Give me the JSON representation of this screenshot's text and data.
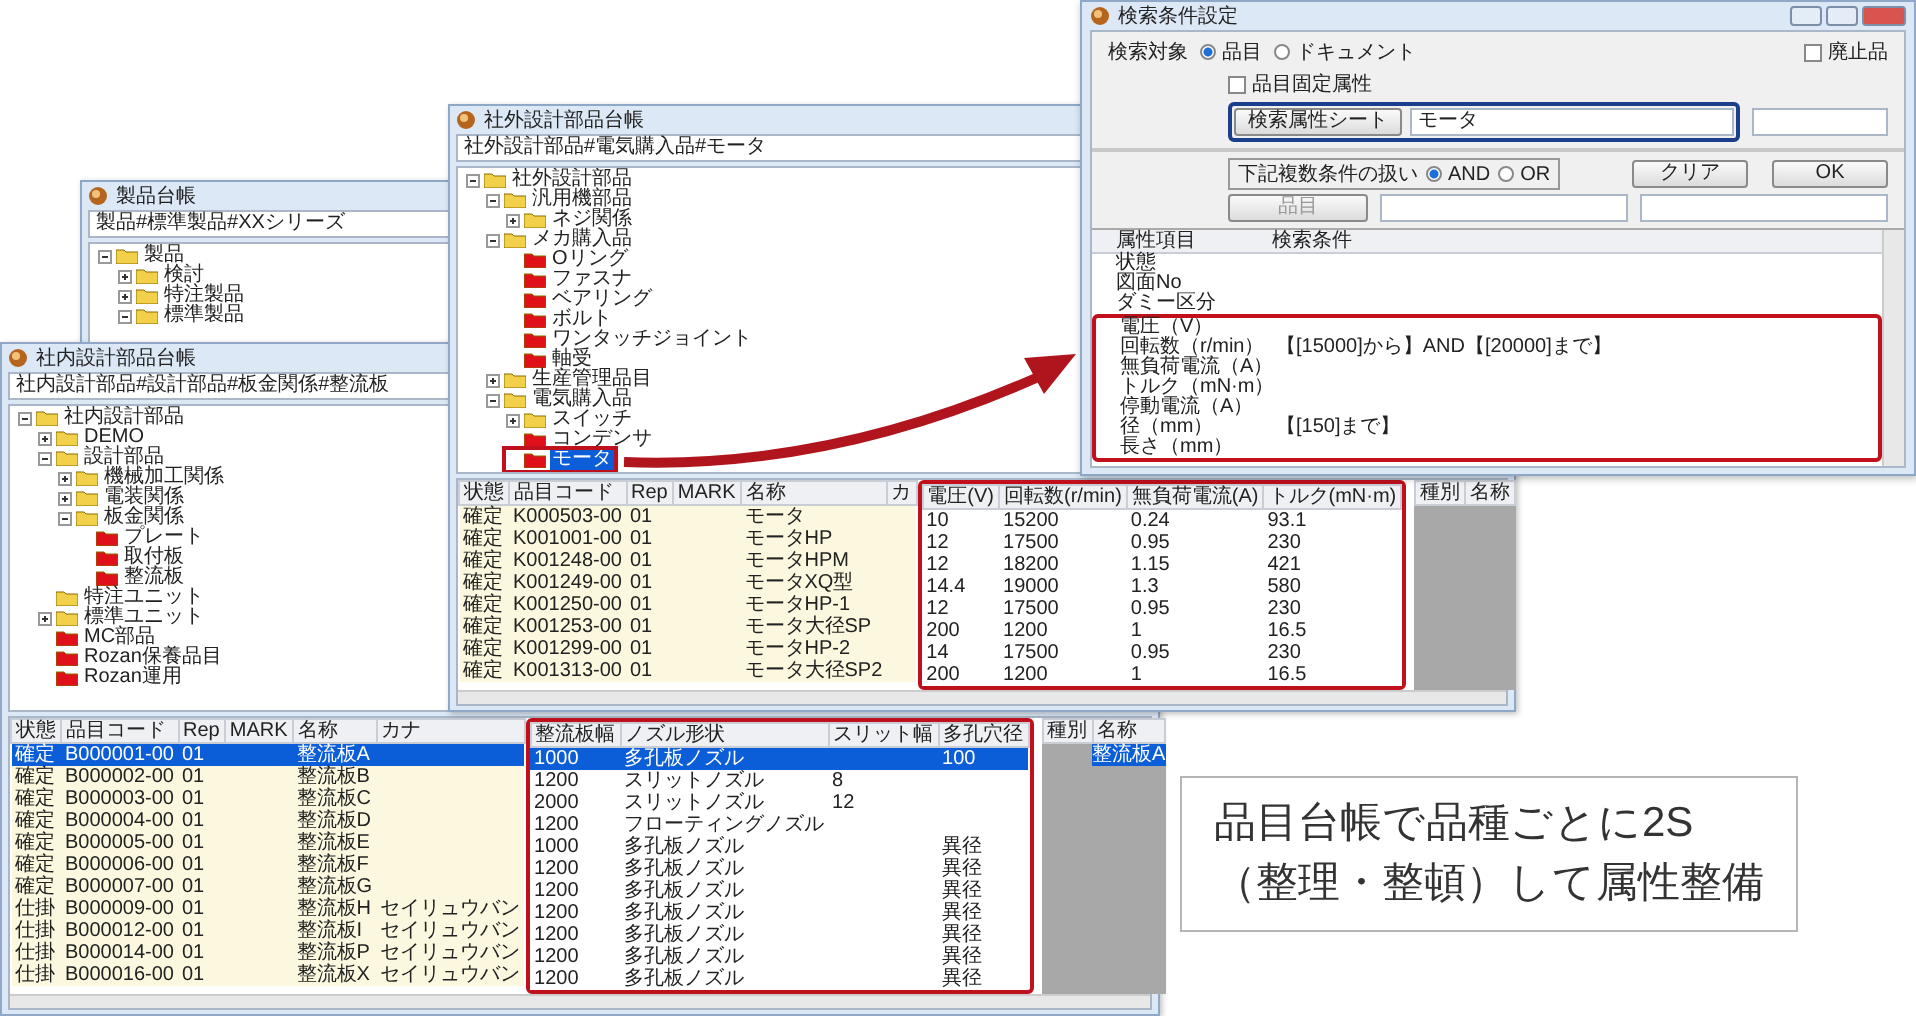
{
  "back_window": {
    "title": "製品台帳",
    "path": "製品#標準製品#XXシリーズ",
    "tree": [
      {
        "label": "製品",
        "kind": "folder",
        "expanded": true,
        "selected": false,
        "children": [
          {
            "label": "検討",
            "kind": "folder",
            "expanded": false,
            "selected": false
          },
          {
            "label": "特注製品",
            "kind": "folder",
            "expanded": false,
            "selected": false
          },
          {
            "label": "標準製品",
            "kind": "folder",
            "expanded": true,
            "selected": false
          }
        ]
      }
    ]
  },
  "left_window": {
    "title": "社内設計部品台帳",
    "path": "社内設計部品#設計部品#板金関係#整流板",
    "tree": [
      {
        "label": "社内設計部品",
        "kind": "folder",
        "expanded": true,
        "selected": false,
        "children": [
          {
            "label": "DEMO",
            "kind": "folder",
            "expanded": false,
            "selected": false
          },
          {
            "label": "設計部品",
            "kind": "folder",
            "expanded": true,
            "selected": false,
            "children": [
              {
                "label": "機械加工関係",
                "kind": "folder",
                "expanded": false,
                "selected": false
              },
              {
                "label": "電装関係",
                "kind": "folder",
                "expanded": false,
                "selected": false
              },
              {
                "label": "板金関係",
                "kind": "folder",
                "expanded": true,
                "selected": false,
                "children": [
                  {
                    "label": "プレート",
                    "kind": "leaf",
                    "selected": false
                  },
                  {
                    "label": "取付板",
                    "kind": "leaf",
                    "selected": false
                  },
                  {
                    "label": "整流板",
                    "kind": "leaf",
                    "selected": false
                  }
                ]
              }
            ]
          },
          {
            "label": "特注ユニット",
            "kind": "folder",
            "selected": false
          },
          {
            "label": "標準ユニット",
            "kind": "folder",
            "expanded": false,
            "selected": false
          },
          {
            "label": "MC部品",
            "kind": "leaf",
            "selected": false
          },
          {
            "label": "Rozan保養品目",
            "kind": "leaf",
            "selected": false
          },
          {
            "label": "Rozan運用",
            "kind": "leaf",
            "selected": false
          }
        ]
      }
    ],
    "table": {
      "columns": [
        "状態",
        "品目コード",
        "Rep",
        "MARK",
        "名称",
        "カナ"
      ],
      "highlighted_columns": [
        "整流板幅",
        "ノズル形状",
        "スリット幅",
        "多孔穴径"
      ],
      "rows": [
        {
          "selected": true,
          "cells": [
            "確定",
            "B000001-00",
            "01",
            null,
            "整流板A",
            null
          ],
          "highlighted_cells": [
            "1000",
            "多孔板ノズル",
            null,
            "100"
          ]
        },
        {
          "selected": false,
          "cells": [
            "確定",
            "B000002-00",
            "01",
            null,
            "整流板B",
            null
          ],
          "highlighted_cells": [
            "1200",
            "スリットノズル",
            "8",
            null
          ]
        },
        {
          "selected": false,
          "cells": [
            "確定",
            "B000003-00",
            "01",
            null,
            "整流板C",
            null
          ],
          "highlighted_cells": [
            "2000",
            "スリットノズル",
            "12",
            null
          ]
        },
        {
          "selected": false,
          "cells": [
            "確定",
            "B000004-00",
            "01",
            null,
            "整流板D",
            null
          ],
          "highlighted_cells": [
            "1200",
            "フローティングノズル",
            null,
            null
          ]
        },
        {
          "selected": false,
          "cells": [
            "確定",
            "B000005-00",
            "01",
            null,
            "整流板E",
            null
          ],
          "highlighted_cells": [
            "1000",
            "多孔板ノズル",
            null,
            "異径"
          ]
        },
        {
          "selected": false,
          "cells": [
            "確定",
            "B000006-00",
            "01",
            null,
            "整流板F",
            null
          ],
          "highlighted_cells": [
            "1200",
            "多孔板ノズル",
            null,
            "異径"
          ]
        },
        {
          "selected": false,
          "cells": [
            "確定",
            "B000007-00",
            "01",
            null,
            "整流板G",
            null
          ],
          "highlighted_cells": [
            "1200",
            "多孔板ノズル",
            null,
            "異径"
          ]
        },
        {
          "selected": false,
          "cells": [
            "仕掛",
            "B000009-00",
            "01",
            null,
            "整流板H",
            "セイリュウバン"
          ],
          "highlighted_cells": [
            "1200",
            "多孔板ノズル",
            null,
            "異径"
          ]
        },
        {
          "selected": false,
          "cells": [
            "仕掛",
            "B000012-00",
            "01",
            null,
            "整流板I",
            "セイリュウバン"
          ],
          "highlighted_cells": [
            "1200",
            "多孔板ノズル",
            null,
            "異径"
          ]
        },
        {
          "selected": false,
          "cells": [
            "仕掛",
            "B000014-00",
            "01",
            null,
            "整流板P",
            "セイリュウバン"
          ],
          "highlighted_cells": [
            "1200",
            "多孔板ノズル",
            null,
            "異径"
          ]
        },
        {
          "selected": false,
          "cells": [
            "仕掛",
            "B000016-00",
            "01",
            null,
            "整流板X",
            "セイリュウバン"
          ],
          "highlighted_cells": [
            "1200",
            "多孔板ノズル",
            null,
            "異径"
          ]
        }
      ]
    },
    "side_table": {
      "columns": [
        "種別",
        "名称"
      ],
      "rows": [
        {
          "selected": true,
          "cells": [
            null,
            "整流板A"
          ]
        }
      ]
    }
  },
  "middle_window": {
    "title": "社外設計部品台帳",
    "path": "社外設計部品#電気購入品#モータ",
    "tree": [
      {
        "label": "社外設計部品",
        "kind": "folder",
        "expanded": true,
        "selected": false,
        "children": [
          {
            "label": "汎用機部品",
            "kind": "folder",
            "expanded": true,
            "selected": false,
            "children": [
              {
                "label": "ネジ関係",
                "kind": "folder",
                "expanded": false,
                "selected": false
              }
            ]
          },
          {
            "label": "メカ購入品",
            "kind": "folder",
            "expanded": true,
            "selected": false,
            "children": [
              {
                "label": "Oリング",
                "kind": "leaf",
                "selected": false
              },
              {
                "label": "ファスナ",
                "kind": "leaf",
                "selected": false
              },
              {
                "label": "ベアリング",
                "kind": "leaf",
                "selected": false
              },
              {
                "label": "ボルト",
                "kind": "leaf",
                "selected": false
              },
              {
                "label": "ワンタッチジョイント",
                "kind": "leaf",
                "selected": false
              },
              {
                "label": "軸受",
                "kind": "leaf",
                "selected": false
              }
            ]
          },
          {
            "label": "生産管理品目",
            "kind": "folder",
            "expanded": false,
            "selected": false
          },
          {
            "label": "電気購入品",
            "kind": "folder",
            "expanded": true,
            "selected": false,
            "children": [
              {
                "label": "スイッチ",
                "kind": "folder",
                "expanded": false,
                "selected": false
              },
              {
                "label": "コンデンサ",
                "kind": "leaf",
                "selected": false
              },
              {
                "label": "モータ",
                "kind": "leaf",
                "selected": true,
                "highlighted": true
              }
            ]
          }
        ]
      }
    ],
    "table": {
      "columns": [
        "状態",
        "品目コード",
        "Rep",
        "MARK",
        "名称",
        "カ"
      ],
      "highlighted_columns": [
        "電圧(V)",
        "回転数(r/min)",
        "無負荷電流(A)",
        "トルク(mN·m)"
      ],
      "rows": [
        {
          "selected": false,
          "cells": [
            "確定",
            "K000503-00",
            "01",
            null,
            "モータ",
            null
          ],
          "highlighted_cells": [
            "10",
            "15200",
            "0.24",
            "93.1"
          ]
        },
        {
          "selected": false,
          "cells": [
            "確定",
            "K001001-00",
            "01",
            null,
            "モータHP",
            null
          ],
          "highlighted_cells": [
            "12",
            "17500",
            "0.95",
            "230"
          ]
        },
        {
          "selected": false,
          "cells": [
            "確定",
            "K001248-00",
            "01",
            null,
            "モータHPM",
            null
          ],
          "highlighted_cells": [
            "12",
            "18200",
            "1.15",
            "421"
          ]
        },
        {
          "selected": false,
          "cells": [
            "確定",
            "K001249-00",
            "01",
            null,
            "モータXQ型",
            null
          ],
          "highlighted_cells": [
            "14.4",
            "19000",
            "1.3",
            "580"
          ]
        },
        {
          "selected": false,
          "cells": [
            "確定",
            "K001250-00",
            "01",
            null,
            "モータHP-1",
            null
          ],
          "highlighted_cells": [
            "12",
            "17500",
            "0.95",
            "230"
          ]
        },
        {
          "selected": false,
          "cells": [
            "確定",
            "K001253-00",
            "01",
            null,
            "モータ大径SP",
            null
          ],
          "highlighted_cells": [
            "200",
            "1200",
            "1",
            "16.5"
          ]
        },
        {
          "selected": false,
          "cells": [
            "確定",
            "K001299-00",
            "01",
            null,
            "モータHP-2",
            null
          ],
          "highlighted_cells": [
            "14",
            "17500",
            "0.95",
            "230"
          ]
        },
        {
          "selected": false,
          "cells": [
            "確定",
            "K001313-00",
            "01",
            null,
            "モータ大径SP2",
            null
          ],
          "highlighted_cells": [
            "200",
            "1200",
            "1",
            "16.5"
          ]
        }
      ]
    },
    "side_table": {
      "columns": [
        "種別",
        "名称"
      ]
    }
  },
  "dialog": {
    "title": "検索条件設定",
    "target_label": "検索対象",
    "target_options": [
      {
        "label": "品目",
        "selected": true
      },
      {
        "label": "ドキュメント",
        "selected": false
      }
    ],
    "obsolete_checkbox": {
      "label": "廃止品",
      "checked": false
    },
    "fixed_attr_checkbox": {
      "label": "品目固定属性",
      "checked": false
    },
    "sheet_button": "検索属性シート",
    "sheet_field": {
      "value": "モータ"
    },
    "condition_label": "下記複数条件の扱い",
    "condition_options": [
      {
        "label": "AND",
        "selected": true
      },
      {
        "label": "OR",
        "selected": false
      }
    ],
    "clear_button": "クリア",
    "ok_button": "OK",
    "item_button": {
      "label": "品目",
      "disabled": true
    },
    "grid": {
      "columns": [
        "属性項目",
        "検索条件"
      ],
      "rows": [
        {
          "attribute": "状態"
        },
        {
          "attribute": "図面No"
        },
        {
          "attribute": "ダミー区分"
        }
      ],
      "highlighted_rows": [
        {
          "attribute": "電圧（V）"
        },
        {
          "attribute": "回転数（r/min）",
          "condition": "【[15000]から】AND【[20000]まで】"
        },
        {
          "attribute": "無負荷電流（A）"
        },
        {
          "attribute": "トルク（mN·m）"
        },
        {
          "attribute": "停動電流（A）"
        },
        {
          "attribute": "径（mm）",
          "condition": "【[150]まで】"
        },
        {
          "attribute": "長さ（mm）"
        }
      ]
    }
  },
  "callout": {
    "lines": [
      "品目台帳で品種ごとに2S",
      "（整理・整頓）して属性整備"
    ]
  }
}
